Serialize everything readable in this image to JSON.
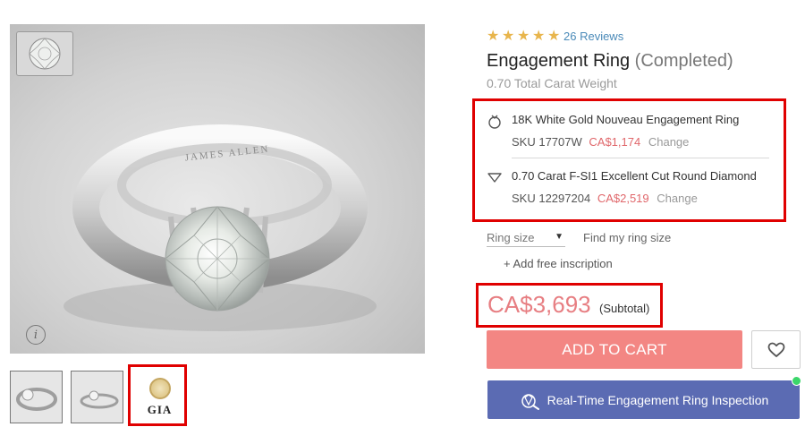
{
  "product": {
    "rating": {
      "stars": 5,
      "reviews_label": "26 Reviews"
    },
    "title": "Engagement Ring",
    "status": "(Completed)",
    "carat_weight": "0.70 Total Carat Weight",
    "ring_engraving": "JAMES ALLEN",
    "components": [
      {
        "icon": "ring-setting-icon",
        "name": "18K White Gold Nouveau Engagement Ring",
        "sku_label": "SKU 17707W",
        "price": "CA$1,174",
        "change_label": "Change"
      },
      {
        "icon": "diamond-icon",
        "name": "0.70 Carat F-SI1 Excellent Cut Round Diamond",
        "sku_label": "SKU 12297204",
        "price": "CA$2,519",
        "change_label": "Change"
      }
    ],
    "ring_size": {
      "selected": "Ring size"
    },
    "find_ring_size_label": "Find my ring size",
    "inscription_label": "+ Add free inscription",
    "price": "CA$3,693",
    "subtotal_label": "(Subtotal)",
    "add_to_cart_label": "ADD TO CART",
    "inspection_label": "Real-Time Engagement Ring Inspection"
  },
  "media": {
    "info_glyph": "i",
    "thumbnails": [
      {
        "name": "ring-side-view"
      },
      {
        "name": "ring-angle-view"
      },
      {
        "name": "gia-certificate",
        "label": "GIA"
      }
    ]
  },
  "colors": {
    "star": "#e8b54c",
    "price": "#e77e82",
    "add_to_cart": "#f38683",
    "inspection": "#5b6bb3",
    "highlight_box": "#e00000",
    "online_dot": "#3bd66a"
  }
}
